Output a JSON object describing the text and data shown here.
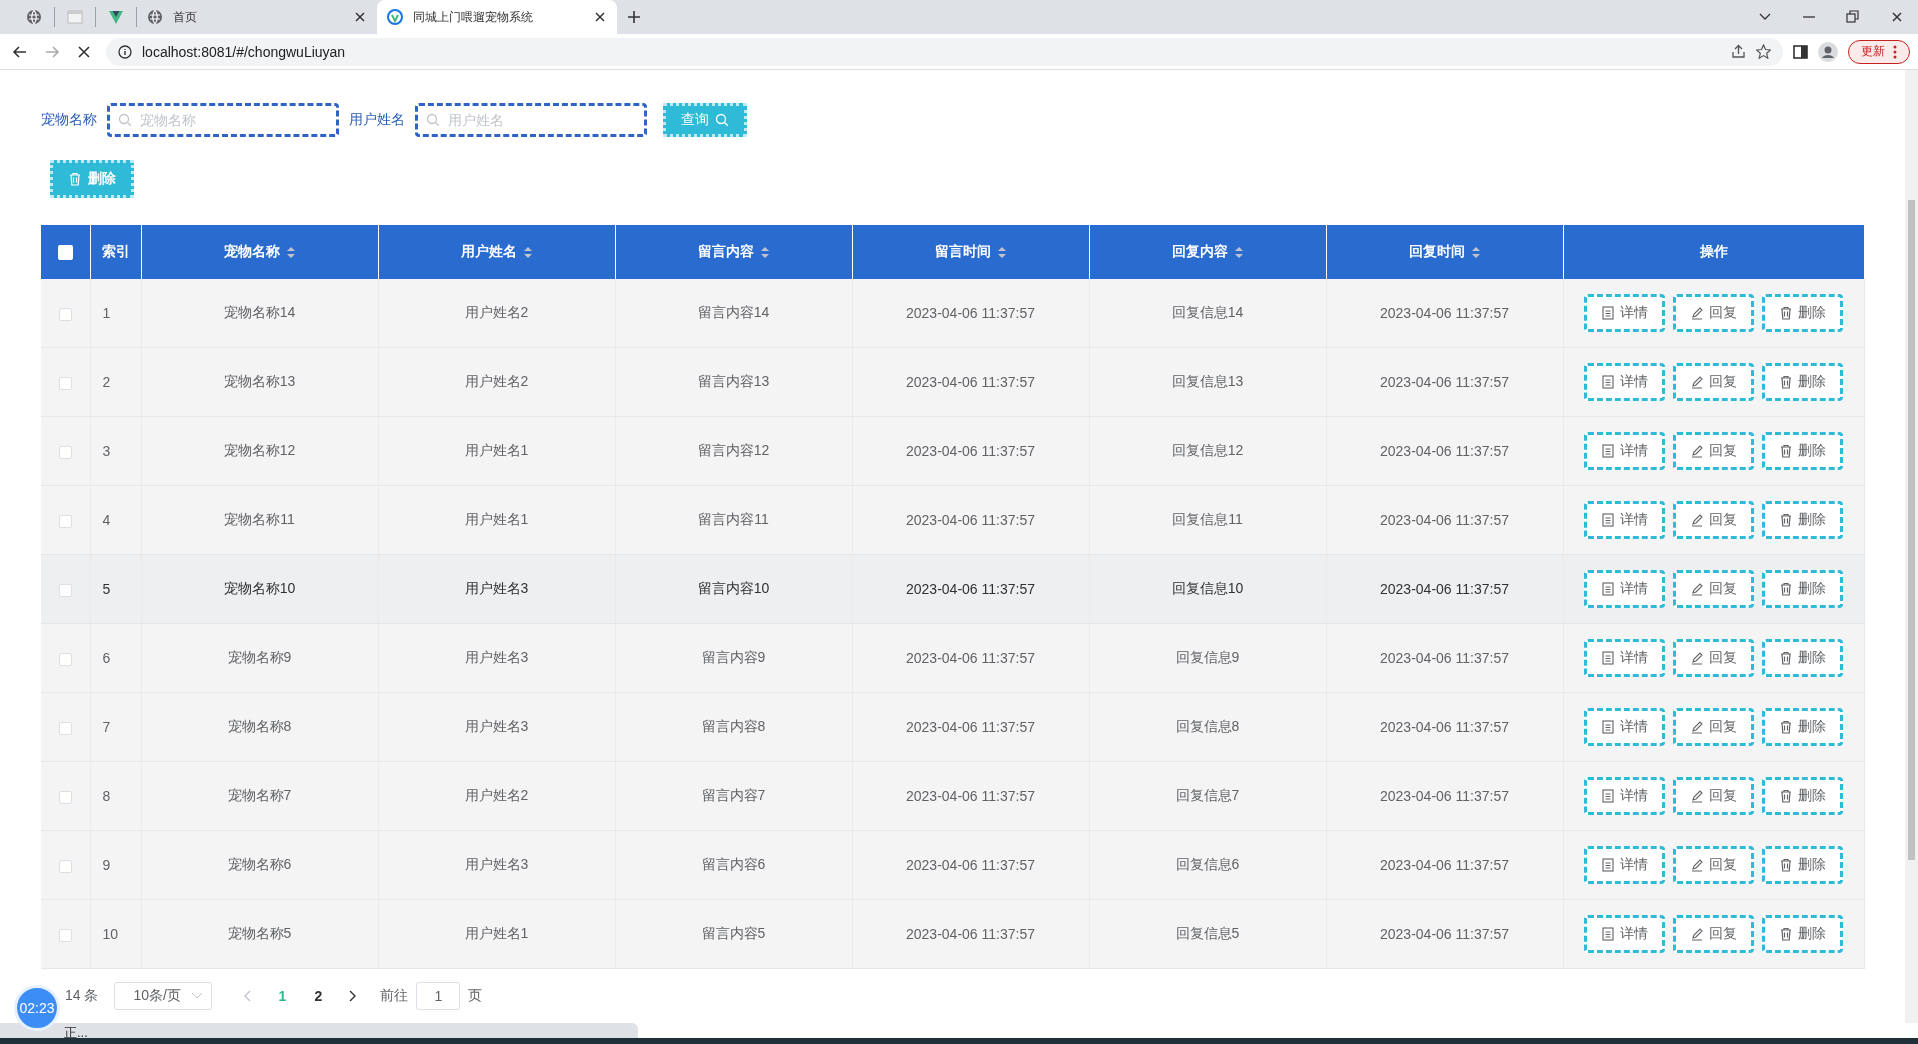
{
  "browser": {
    "tabs": [
      {
        "kind": "pinned",
        "selected": false
      },
      {
        "kind": "pinned",
        "selected": false
      },
      {
        "kind": "pinned",
        "selected": false
      },
      {
        "kind": "page",
        "title": "首页",
        "selected": false
      },
      {
        "kind": "page",
        "title": "同城上门喂遛宠物系统",
        "selected": true
      }
    ],
    "address": "localhost:8081/#/chongwuLiuyan",
    "loading": true,
    "update_button": "更新"
  },
  "filters": [
    {
      "label": "宠物名称",
      "placeholder": "宠物名称"
    },
    {
      "label": "用户姓名",
      "placeholder": "用户姓名"
    }
  ],
  "search_button": "查询",
  "delete_button": "删除",
  "table": {
    "select_all": {
      "checked": false
    },
    "columns": [
      {
        "label": "索引",
        "sortable": false
      },
      {
        "label": "宠物名称",
        "sortable": true
      },
      {
        "label": "用户姓名",
        "sortable": true
      },
      {
        "label": "留言内容",
        "sortable": true
      },
      {
        "label": "留言时间",
        "sortable": true
      },
      {
        "label": "回复内容",
        "sortable": true
      },
      {
        "label": "回复时间",
        "sortable": true
      },
      {
        "label": "操作",
        "sortable": false
      }
    ],
    "rows": [
      {
        "checked": false,
        "hovered": false,
        "cells": [
          "1",
          "宠物名称14",
          "用户姓名2",
          "留言内容14",
          "2023-04-06 11:37:57",
          "回复信息14",
          "2023-04-06 11:37:57"
        ],
        "actions": [
          "详情",
          "回复",
          "删除"
        ]
      },
      {
        "checked": false,
        "hovered": false,
        "cells": [
          "2",
          "宠物名称13",
          "用户姓名2",
          "留言内容13",
          "2023-04-06 11:37:57",
          "回复信息13",
          "2023-04-06 11:37:57"
        ],
        "actions": [
          "详情",
          "回复",
          "删除"
        ]
      },
      {
        "checked": false,
        "hovered": false,
        "cells": [
          "3",
          "宠物名称12",
          "用户姓名1",
          "留言内容12",
          "2023-04-06 11:37:57",
          "回复信息12",
          "2023-04-06 11:37:57"
        ],
        "actions": [
          "详情",
          "回复",
          "删除"
        ]
      },
      {
        "checked": false,
        "hovered": false,
        "cells": [
          "4",
          "宠物名称11",
          "用户姓名1",
          "留言内容11",
          "2023-04-06 11:37:57",
          "回复信息11",
          "2023-04-06 11:37:57"
        ],
        "actions": [
          "详情",
          "回复",
          "删除"
        ]
      },
      {
        "checked": false,
        "hovered": true,
        "cells": [
          "5",
          "宠物名称10",
          "用户姓名3",
          "留言内容10",
          "2023-04-06 11:37:57",
          "回复信息10",
          "2023-04-06 11:37:57"
        ],
        "actions": [
          "详情",
          "回复",
          "删除"
        ]
      },
      {
        "checked": false,
        "hovered": false,
        "cells": [
          "6",
          "宠物名称9",
          "用户姓名3",
          "留言内容9",
          "2023-04-06 11:37:57",
          "回复信息9",
          "2023-04-06 11:37:57"
        ],
        "actions": [
          "详情",
          "回复",
          "删除"
        ]
      },
      {
        "checked": false,
        "hovered": false,
        "cells": [
          "7",
          "宠物名称8",
          "用户姓名3",
          "留言内容8",
          "2023-04-06 11:37:57",
          "回复信息8",
          "2023-04-06 11:37:57"
        ],
        "actions": [
          "详情",
          "回复",
          "删除"
        ]
      },
      {
        "checked": false,
        "hovered": false,
        "cells": [
          "8",
          "宠物名称7",
          "用户姓名2",
          "留言内容7",
          "2023-04-06 11:37:57",
          "回复信息7",
          "2023-04-06 11:37:57"
        ],
        "actions": [
          "详情",
          "回复",
          "删除"
        ]
      },
      {
        "checked": false,
        "hovered": false,
        "cells": [
          "9",
          "宠物名称6",
          "用户姓名3",
          "留言内容6",
          "2023-04-06 11:37:57",
          "回复信息6",
          "2023-04-06 11:37:57"
        ],
        "actions": [
          "详情",
          "回复",
          "删除"
        ]
      },
      {
        "checked": false,
        "hovered": false,
        "cells": [
          "10",
          "宠物名称5",
          "用户姓名1",
          "留言内容5",
          "2023-04-06 11:37:57",
          "回复信息5",
          "2023-04-06 11:37:57"
        ],
        "actions": [
          "详情",
          "回复",
          "删除"
        ]
      }
    ]
  },
  "pagination": {
    "total": "14 条",
    "page_size": "10条/页",
    "pages": [
      {
        "label": "1",
        "selected": true
      },
      {
        "label": "2",
        "selected": false
      }
    ],
    "goto_label": "前往",
    "goto_value": "1",
    "goto_suffix": "页"
  },
  "timer": "02:23",
  "status": "正..."
}
